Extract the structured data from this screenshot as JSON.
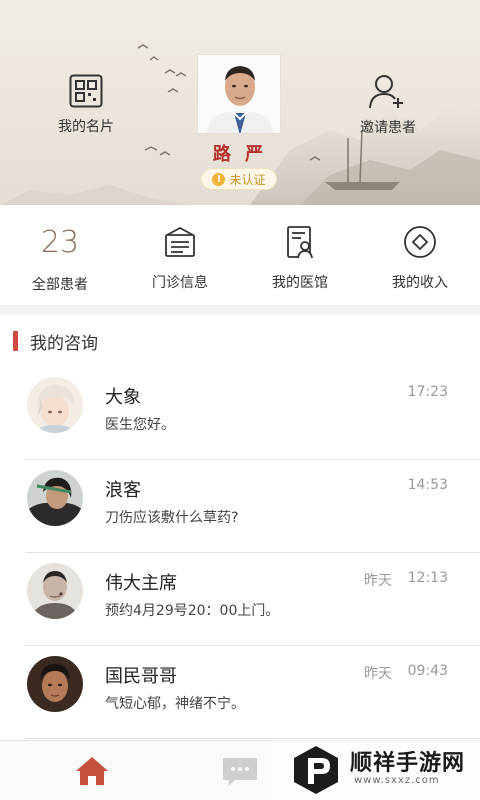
{
  "header": {
    "card_label": "我的名片",
    "invite_label": "邀请患者",
    "doctor_name": "路 严",
    "verify_status": "未认证",
    "verify_icon_glyph": "!",
    "colors": {
      "name": "#b5302a",
      "badge_text": "#c8962c",
      "badge_icon": "#f2b43c"
    }
  },
  "stats": {
    "patients_count": "23",
    "patients_label": "全部患者",
    "clinic_label": "门诊信息",
    "hall_label": "我的医馆",
    "income_label": "我的收入",
    "icons": [
      "clinic-info-icon",
      "hospital-icon",
      "income-icon"
    ]
  },
  "consult": {
    "title": "我的咨询",
    "accent": "#d0493f",
    "items": [
      {
        "name": "大象",
        "message": "医生您好。",
        "day": "",
        "time": "17:23"
      },
      {
        "name": "浪客",
        "message": "刀伤应该敷什么草药?",
        "day": "",
        "time": "14:53"
      },
      {
        "name": "伟大主席",
        "message": "预约4月29号20：00上门。",
        "day": "昨天",
        "time": "12:13"
      },
      {
        "name": "国民哥哥",
        "message": "气短心郁，神绪不宁。",
        "day": "昨天",
        "time": "09:43"
      }
    ]
  },
  "tabbar": {
    "icons": [
      "home-icon",
      "message-icon"
    ],
    "active_color": "#c4513e"
  },
  "watermark": {
    "title": "顺祥手游网",
    "url": "www.sxxz.com"
  }
}
